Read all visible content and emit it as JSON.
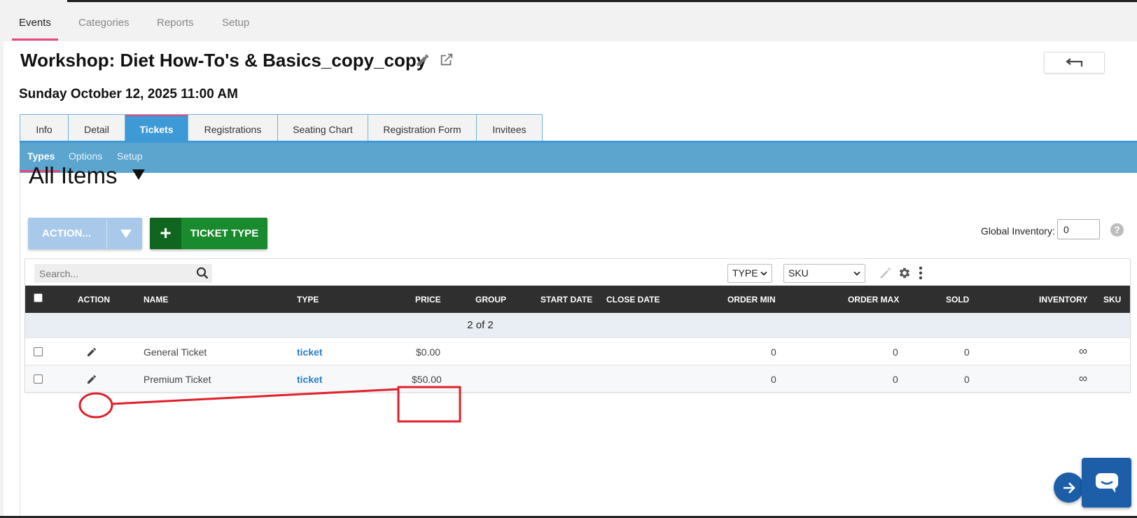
{
  "topnav": {
    "tabs": [
      {
        "label": "Events",
        "active": true
      },
      {
        "label": "Categories"
      },
      {
        "label": "Reports"
      },
      {
        "label": "Setup"
      }
    ]
  },
  "event": {
    "title": "Workshop: Diet How-To's & Basics_copy_copy",
    "date": "Sunday October 12, 2025 11:00 AM"
  },
  "tabs": [
    {
      "label": "Info"
    },
    {
      "label": "Detail"
    },
    {
      "label": "Tickets",
      "active": true
    },
    {
      "label": "Registrations"
    },
    {
      "label": "Seating Chart"
    },
    {
      "label": "Registration Form"
    },
    {
      "label": "Invitees"
    }
  ],
  "subtabs": [
    {
      "label": "Types",
      "active": true
    },
    {
      "label": "Options"
    },
    {
      "label": "Setup"
    }
  ],
  "view": {
    "title": "All Items"
  },
  "buttons": {
    "action": "ACTION...",
    "ticket_type": "TICKET TYPE"
  },
  "inventory": {
    "label": "Global Inventory:",
    "value": "0"
  },
  "grid": {
    "search_placeholder": "Search...",
    "type_select": "TYPE",
    "sku_select": "SKU",
    "columns": [
      "ACTION",
      "NAME",
      "TYPE",
      "PRICE",
      "GROUP",
      "START DATE",
      "CLOSE DATE",
      "ORDER MIN",
      "ORDER MAX",
      "SOLD",
      "INVENTORY",
      "SKU"
    ],
    "count": "2 of 2",
    "rows": [
      {
        "name": "General Ticket",
        "type": "ticket",
        "price": "$0.00",
        "order_min": "0",
        "order_max": "0",
        "sold": "0",
        "inventory": "∞"
      },
      {
        "name": "Premium Ticket",
        "type": "ticket",
        "price": "$50.00",
        "order_min": "0",
        "order_max": "0",
        "sold": "0",
        "inventory": "∞"
      }
    ]
  },
  "colors": {
    "accent": "#3e9ad6",
    "subbar": "#5ba5cf",
    "pink": "#e8487a",
    "green": "#1a8a2e",
    "annotation": "#e0202a"
  },
  "help": {
    "glyph": "?"
  },
  "icons": [
    "pencil-icon",
    "external-link-icon",
    "return-icon",
    "search-icon",
    "chevron-down-icon",
    "magic-wand-icon",
    "gear-icon",
    "kebab-icon",
    "arrow-right-icon",
    "chat-icon",
    "plus-icon"
  ]
}
